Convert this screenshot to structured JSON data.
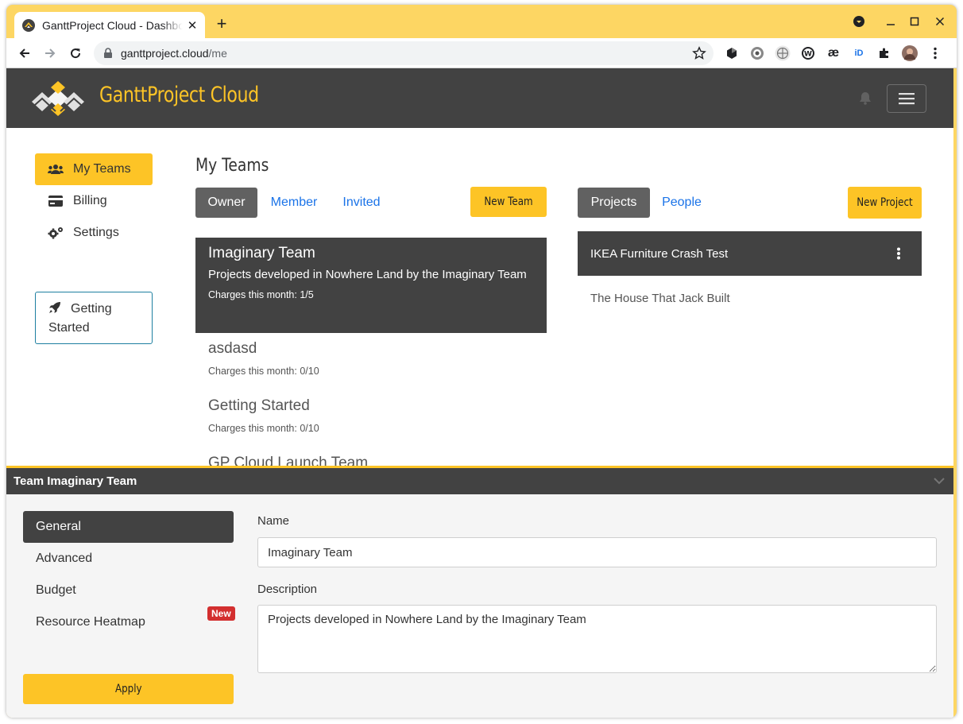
{
  "browser": {
    "tab_title": "GanttProject Cloud - Dashboard",
    "new_tab": "+",
    "url_host": "ganttproject.cloud",
    "url_path": "/me",
    "extensions": [
      "hexagon-icon",
      "gear-badge-icon",
      "globe-icon",
      "wordpress-icon",
      "ae-icon",
      "id-icon",
      "puzzle-icon",
      "profile-avatar"
    ],
    "ext_ae": "æ",
    "ext_id": "iD"
  },
  "header": {
    "brand": "GanttProject Cloud",
    "colors": {
      "bar": "#424242",
      "accent": "#fdc426"
    }
  },
  "sidebar": {
    "items": [
      {
        "label": "My Teams",
        "icon": "users-icon",
        "active": true
      },
      {
        "label": "Billing",
        "icon": "credit-card-icon",
        "active": false
      },
      {
        "label": "Settings",
        "icon": "gears-icon",
        "active": false
      }
    ],
    "getting_started": "Getting Started"
  },
  "main": {
    "title": "My Teams",
    "team_tabs": [
      {
        "label": "Owner",
        "active": true
      },
      {
        "label": "Member",
        "active": false
      },
      {
        "label": "Invited",
        "active": false
      }
    ],
    "new_team": "New Team",
    "teams": [
      {
        "name": "Imaginary Team",
        "description": "Projects developed in Nowhere Land by the Imaginary Team",
        "charges": "Charges this month: 1/5",
        "active": true
      },
      {
        "name": "asdasd",
        "charges": "Charges this month: 0/10",
        "active": false
      },
      {
        "name": "Getting Started",
        "charges": "Charges this month: 0/10",
        "active": false
      },
      {
        "name": "GP Cloud Launch Team",
        "charges": "",
        "active": false
      }
    ],
    "project_tabs": [
      {
        "label": "Projects",
        "active": true
      },
      {
        "label": "People",
        "active": false
      }
    ],
    "new_project": "New Project",
    "projects": [
      {
        "name": "IKEA Furniture Crash Test",
        "active": true
      },
      {
        "name": "The House That Jack Built",
        "active": false
      }
    ]
  },
  "panel": {
    "title": "Team Imaginary Team",
    "tabs": [
      {
        "label": "General",
        "active": true
      },
      {
        "label": "Advanced",
        "active": false
      },
      {
        "label": "Budget",
        "active": false
      },
      {
        "label": "Resource Heatmap",
        "active": false
      }
    ],
    "new_badge": "New",
    "name_label": "Name",
    "name_value": "Imaginary Team",
    "description_label": "Description",
    "description_value": "Projects developed in Nowhere Land by the Imaginary Team",
    "apply": "Apply"
  }
}
